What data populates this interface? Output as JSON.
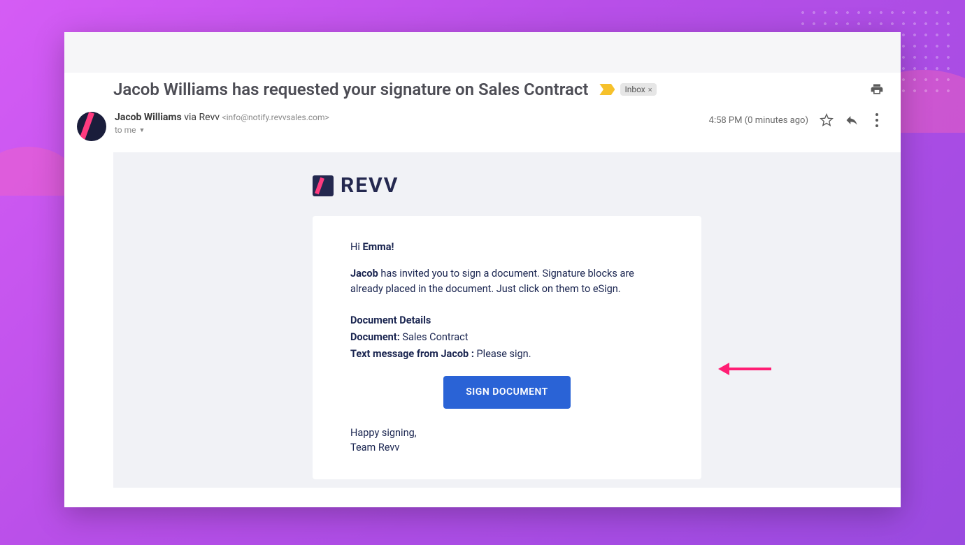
{
  "subject": "Jacob Williams has requested your signature on Sales Contract",
  "label": {
    "name": "Inbox"
  },
  "sender": {
    "name": "Jacob Williams",
    "via": "via Revv",
    "address": "<info@notify.revvsales.com>",
    "to_line": "to me"
  },
  "meta": {
    "time": "4:58 PM (0 minutes ago)"
  },
  "brand": {
    "text": "REVV"
  },
  "body": {
    "greet_prefix": "Hi ",
    "greet_name": "Emma!",
    "inviter": "Jacob",
    "intro_rest": " has invited you to sign a document. Signature blocks are already placed in the document. Just click on them to eSign.",
    "dd_heading": "Document Details",
    "doc_label": "Document:",
    "doc_value": " Sales Contract",
    "msg_label_pre": "Text message from ",
    "msg_label_name": "Jacob",
    "msg_label_sep": "  : ",
    "msg_value": "Please sign.",
    "button": "SIGN DOCUMENT",
    "closing1": "Happy signing,",
    "closing2": "Team Revv"
  }
}
